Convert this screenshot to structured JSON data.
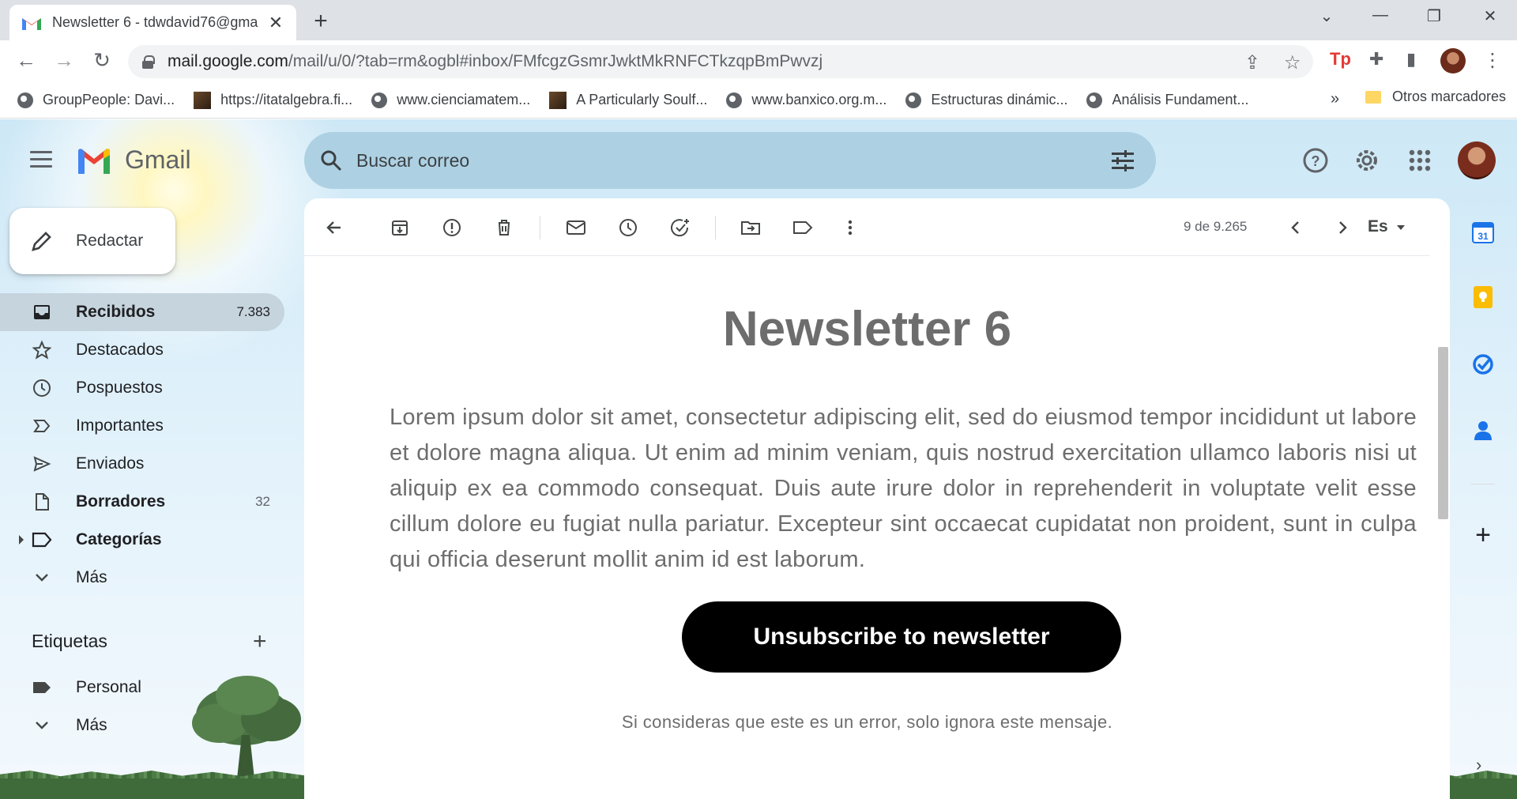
{
  "browser": {
    "tab_title": "Newsletter 6 - tdwdavid76@gma",
    "url_host": "mail.google.com",
    "url_path": "/mail/u/0/?tab=rm&ogbl#inbox/FMfcgzGsmrJwktMkRNFCTkzqpBmPwvzj",
    "bookmarks": [
      {
        "label": "GroupPeople: Davi...",
        "icon": "globe-icon"
      },
      {
        "label": "https://itatalgebra.fi...",
        "icon": "image-icon"
      },
      {
        "label": "www.cienciamatem...",
        "icon": "globe-icon"
      },
      {
        "label": "A Particularly Soulf...",
        "icon": "image-icon"
      },
      {
        "label": "www.banxico.org.m...",
        "icon": "globe-icon"
      },
      {
        "label": "Estructuras dinámic...",
        "icon": "globe-icon"
      },
      {
        "label": "Análisis Fundament...",
        "icon": "globe-icon"
      }
    ],
    "bookmarks_more": "»",
    "other_bookmarks": "Otros marcadores"
  },
  "gmail": {
    "logo_text": "Gmail",
    "search_placeholder": "Buscar correo",
    "compose_label": "Redactar",
    "nav": [
      {
        "label": "Recibidos",
        "count": "7.383",
        "bold": true
      },
      {
        "label": "Destacados",
        "count": "",
        "bold": false
      },
      {
        "label": "Pospuestos",
        "count": "",
        "bold": false
      },
      {
        "label": "Importantes",
        "count": "",
        "bold": false
      },
      {
        "label": "Enviados",
        "count": "",
        "bold": false
      },
      {
        "label": "Borradores",
        "count": "32",
        "bold": true
      },
      {
        "label": "Categorías",
        "count": "",
        "bold": true
      },
      {
        "label": "Más",
        "count": "",
        "bold": false
      }
    ],
    "labels_title": "Etiquetas",
    "labels": [
      {
        "label": "Personal"
      },
      {
        "label": "Más"
      }
    ],
    "pager": "9 de 9.265",
    "language": "Es"
  },
  "email": {
    "title": "Newsletter 6",
    "body": "Lorem ipsum dolor sit amet, consectetur adipiscing elit, sed do eiusmod tempor incididunt ut labore et dolore magna aliqua. Ut enim ad minim veniam, quis nostrud exercitation ullamco laboris nisi ut aliquip ex ea commodo consequat. Duis aute irure dolor in reprehenderit in voluptate velit esse cillum dolore eu fugiat nulla pariatur. Excepteur sint occaecat cupidatat non proident, sunt in culpa qui officia deserunt mollit anim id est laborum.",
    "button": "Unsubscribe to newsletter",
    "footer": "Si consideras que este es un error, solo ignora este mensaje."
  },
  "colors": {
    "accent": "#1a73e8",
    "active_nav": "#c6d4de",
    "search_bg": "#add1e3",
    "button_bg": "#000000"
  }
}
